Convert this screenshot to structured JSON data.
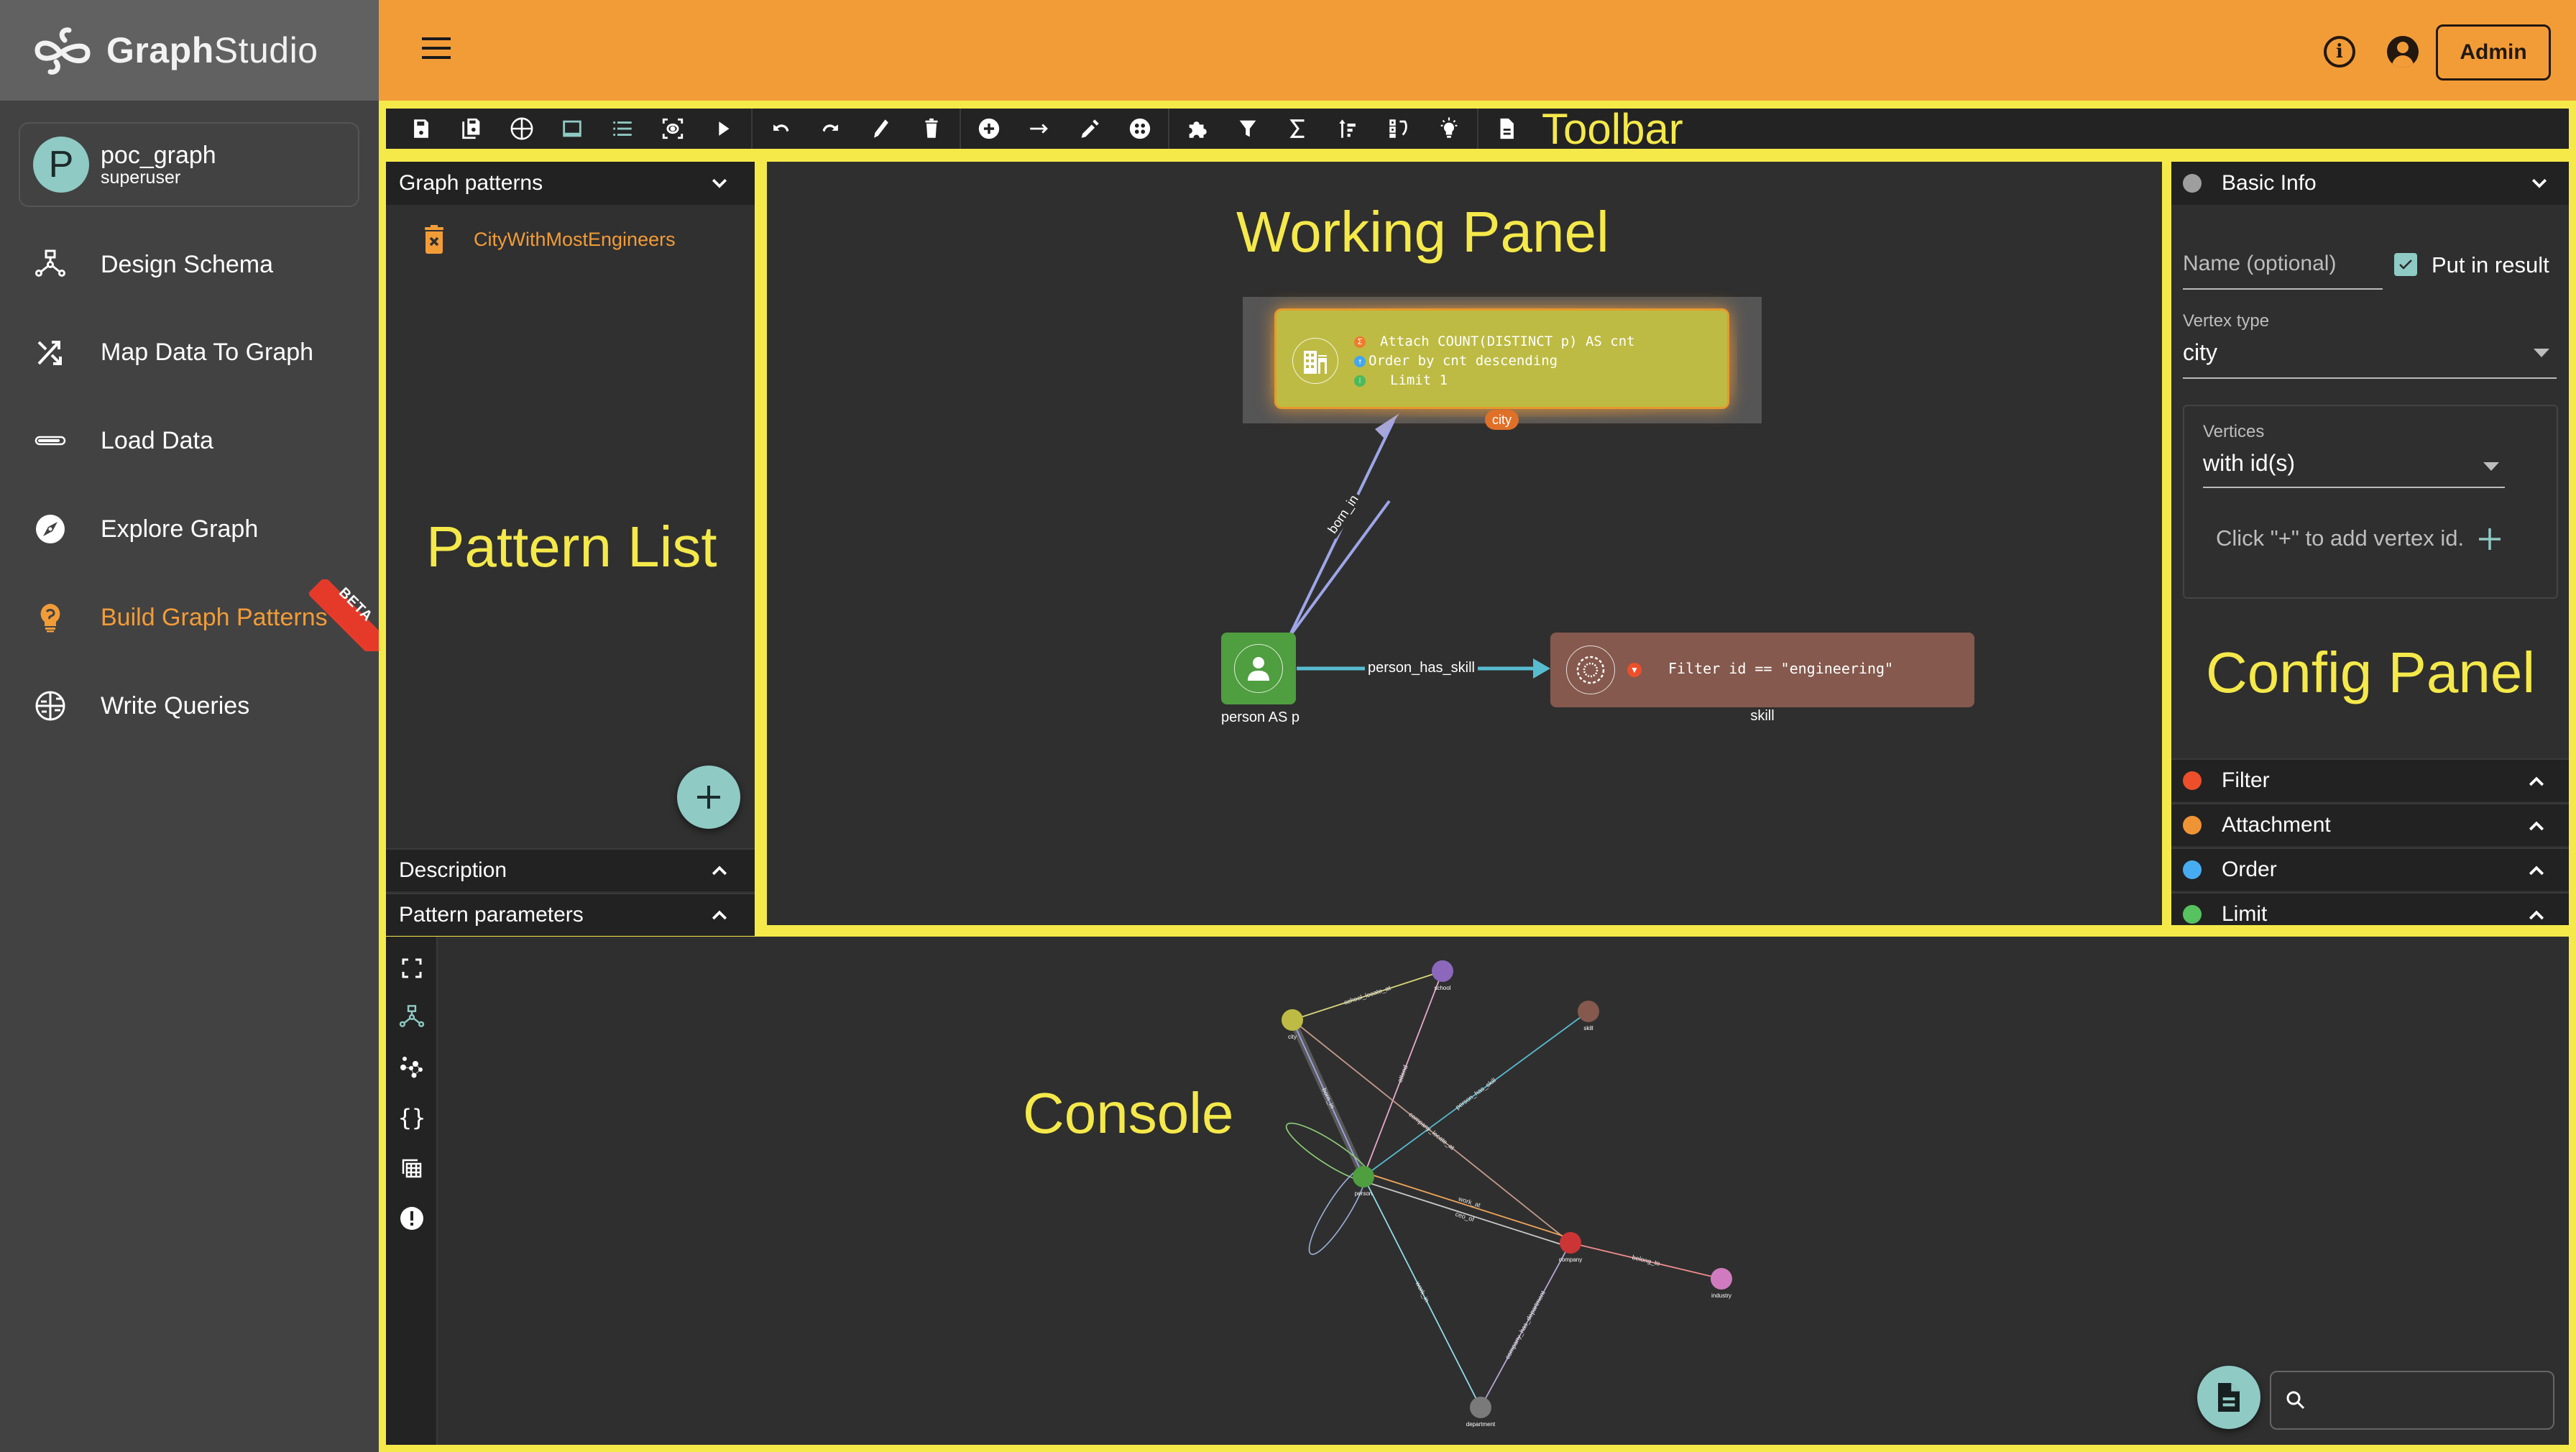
{
  "app": {
    "logo_bold": "Graph",
    "logo_light": "Studio"
  },
  "graph_card": {
    "avatar_letter": "P",
    "name": "poc_graph",
    "role": "superuser"
  },
  "nav": {
    "items": [
      {
        "label": "Design Schema",
        "icon": "schema-icon"
      },
      {
        "label": "Map Data To Graph",
        "icon": "shuffle-icon"
      },
      {
        "label": "Load Data",
        "icon": "progress-bar-icon"
      },
      {
        "label": "Explore Graph",
        "icon": "compass-icon"
      },
      {
        "label": "Build Graph Patterns",
        "icon": "lightbulb-icon",
        "active": true,
        "badge": "BETA"
      },
      {
        "label": "Write Queries",
        "icon": "gsql-icon"
      }
    ]
  },
  "topbar": {
    "admin_label": "Admin",
    "info_glyph": "i"
  },
  "toolbar": {
    "annotation": "Toolbar",
    "groups": [
      [
        "save",
        "save-as",
        "gsql",
        "toggle-panel",
        "list",
        "view",
        "run"
      ],
      [
        "undo",
        "redo",
        "edit",
        "delete"
      ],
      [
        "add-vertex",
        "add-edge",
        "pick",
        "pattern"
      ],
      [
        "widget",
        "filter",
        "aggregate",
        "order",
        "limit",
        "tips"
      ],
      [
        "document"
      ]
    ]
  },
  "pattern_list": {
    "annotation": "Pattern List",
    "header": "Graph patterns",
    "items": [
      {
        "label": "CityWithMostEngineers"
      }
    ],
    "sections": [
      "Description",
      "Pattern parameters"
    ]
  },
  "working_panel": {
    "annotation": "Working Panel",
    "city_node": {
      "type": "city",
      "lines": [
        {
          "kind": "attach",
          "text": "Attach COUNT(DISTINCT p) AS cnt",
          "color": "#f07a2c"
        },
        {
          "kind": "order",
          "text": "Order by cnt descending",
          "color": "#44a7ee"
        },
        {
          "kind": "limit",
          "text": "Limit 1",
          "color": "#4cba5c"
        }
      ]
    },
    "person_node": {
      "label": "person AS p",
      "color": "#4f9e3f"
    },
    "skill_node": {
      "label": "skill",
      "filter": "Filter id == \"engineering\"",
      "color": "#85594d"
    },
    "edges": [
      {
        "label": "born_in",
        "color": "#9ea6e8"
      },
      {
        "label": "person_has_skill",
        "color": "#58bcd0"
      }
    ]
  },
  "config_panel": {
    "annotation": "Config Panel",
    "basic_info_label": "Basic Info",
    "name_placeholder": "Name (optional)",
    "put_in_result_label": "Put in result",
    "put_in_result_checked": true,
    "vertex_type_label": "Vertex type",
    "vertex_type_value": "city",
    "vertices_label": "Vertices",
    "vertices_value": "with id(s)",
    "add_vertex_hint": "Click \"+\" to add vertex id.",
    "sections": [
      {
        "label": "Filter",
        "color": "#ec4f2a"
      },
      {
        "label": "Attachment",
        "color": "#ef9434"
      },
      {
        "label": "Order",
        "color": "#47adf2"
      },
      {
        "label": "Limit",
        "color": "#56c260"
      }
    ]
  },
  "console": {
    "annotation": "Console",
    "search_placeholder": "",
    "rail": [
      "fullscreen-icon",
      "schema-icon",
      "graph-icon",
      "json-icon",
      "table-icon",
      "error-icon"
    ],
    "schema_graph": {
      "nodes": [
        {
          "id": "city",
          "label": "city",
          "color": "#bdbb43"
        },
        {
          "id": "school",
          "label": "school",
          "color": "#8b68bc"
        },
        {
          "id": "skill",
          "label": "skill",
          "color": "#85594d"
        },
        {
          "id": "person",
          "label": "person",
          "color": "#4f9e3f"
        },
        {
          "id": "company",
          "label": "company",
          "color": "#cc3535"
        },
        {
          "id": "industry",
          "label": "industry",
          "color": "#d07bbf"
        },
        {
          "id": "department",
          "label": "department",
          "color": "#7a7a7a"
        }
      ],
      "edges": [
        {
          "from": "city",
          "to": "school",
          "label": "school_locate_at",
          "color": "#d9d77b"
        },
        {
          "from": "school",
          "to": "person",
          "label": "attend",
          "color": "#e8a8cc"
        },
        {
          "from": "skill",
          "to": "person",
          "label": "person_has_skill",
          "color": "#58bcd0"
        },
        {
          "from": "city",
          "to": "person",
          "label": "born_in",
          "color": "#9ea6e8"
        },
        {
          "from": "city",
          "to": "company",
          "label": "company_locate_at",
          "color": "#c49a8a"
        },
        {
          "from": "person",
          "to": "company",
          "label": "work_at",
          "color": "#f2a65a"
        },
        {
          "from": "person",
          "to": "company",
          "label": "ceo_of",
          "color": "#c8c8c8"
        },
        {
          "from": "company",
          "to": "industry",
          "label": "belong_to",
          "color": "#f08c8c"
        },
        {
          "from": "person",
          "to": "department",
          "label": "work_in",
          "color": "#90dce8"
        },
        {
          "from": "company",
          "to": "department",
          "label": "company_has_department",
          "color": "#b4a8d8"
        },
        {
          "from": "person",
          "to": "person",
          "label": "",
          "color": "#8fd17a"
        },
        {
          "from": "person",
          "to": "person",
          "label": "",
          "color": "#9ab0d8"
        }
      ]
    }
  }
}
